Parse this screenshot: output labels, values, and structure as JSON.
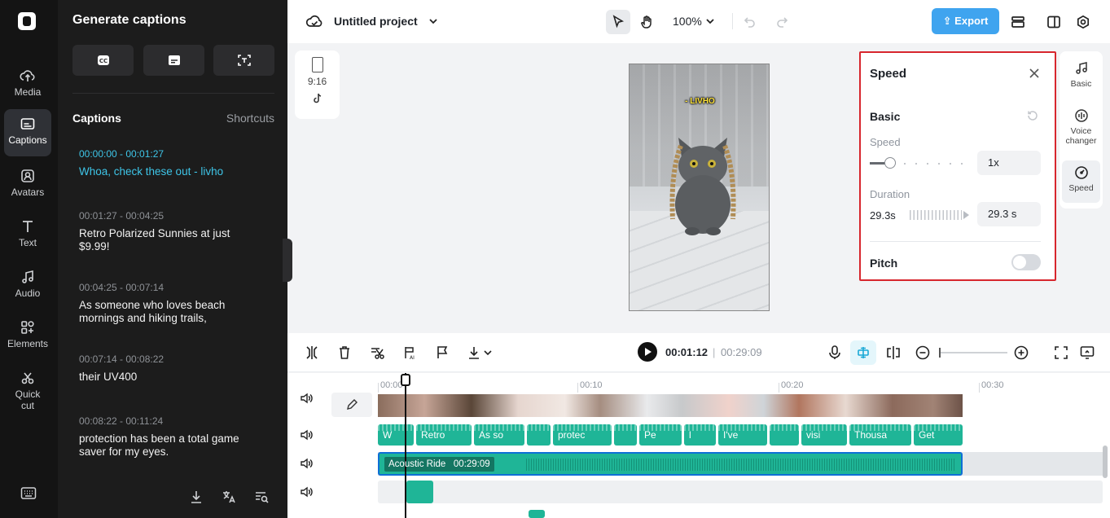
{
  "rail": {
    "items": [
      {
        "label": "Media",
        "icon": "cloud-upload-icon"
      },
      {
        "label": "Captions",
        "icon": "captions-icon"
      },
      {
        "label": "Avatars",
        "icon": "avatar-icon"
      },
      {
        "label": "Text",
        "icon": "text-icon"
      },
      {
        "label": "Audio",
        "icon": "music-note-icon"
      },
      {
        "label": "Elements",
        "icon": "elements-icon"
      },
      {
        "label": "Quick",
        "label2": "cut",
        "icon": "scissors-icon"
      }
    ],
    "active": "Captions"
  },
  "captions_panel": {
    "title": "Generate captions",
    "section": "Captions",
    "shortcuts": "Shortcuts",
    "items": [
      {
        "time": "00:00:00 - 00:01:27",
        "text": "Whoa, check these out - livho",
        "active": true
      },
      {
        "time": "00:01:27 - 00:04:25",
        "text": "Retro Polarized Sunnies at just $9.99!"
      },
      {
        "time": "00:04:25 - 00:07:14",
        "text": "As someone who loves beach mornings and hiking trails,"
      },
      {
        "time": "00:07:14 - 00:08:22",
        "text": "their UV400"
      },
      {
        "time": "00:08:22 - 00:11:24",
        "text": "protection has been a total game saver for my eyes."
      }
    ]
  },
  "topbar": {
    "project_title": "Untitled project",
    "zoom": "100%",
    "export_label": "Export",
    "accent": "#3fa4ef"
  },
  "aspect": {
    "ratio": "9:16"
  },
  "preview": {
    "caption_overlay": "- LIVHO"
  },
  "speed_panel": {
    "title": "Speed",
    "basic": "Basic",
    "speed_label": "Speed",
    "speed_value": "1x",
    "duration_label": "Duration",
    "duration_original": "29.3s",
    "duration_value": "29.3 s",
    "pitch_label": "Pitch",
    "pitch_on": false,
    "highlight": "#d7262d"
  },
  "right_tabs": [
    {
      "label": "Basic",
      "icon": "music-note-icon"
    },
    {
      "label": "Voice changer",
      "icon": "voice-changer-icon"
    },
    {
      "label": "Speed",
      "icon": "speedometer-icon",
      "active": true
    }
  ],
  "timeline": {
    "current": "00:01:12",
    "separator": "|",
    "total": "00:29:09",
    "ruler": [
      "00:00",
      "00:10",
      "00:20",
      "00:30"
    ],
    "caption_clips": [
      "W",
      "Retro",
      "As so",
      "",
      "protec",
      "",
      "Pe",
      "l",
      "I've",
      "",
      "visi",
      "Thousa",
      "Get"
    ],
    "audio_clip_name": "Acoustic Ride",
    "audio_clip_duration": "00:29:09"
  }
}
